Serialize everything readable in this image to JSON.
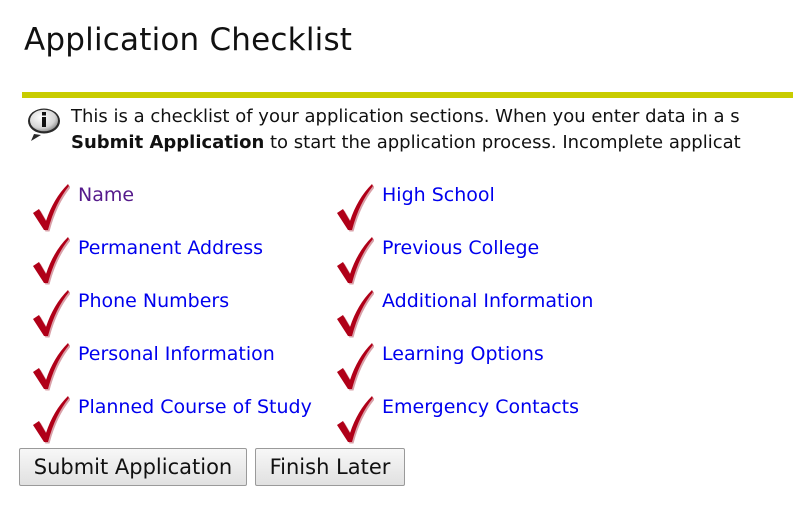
{
  "page": {
    "title": "Application Checklist"
  },
  "colors": {
    "rule": "#c8cc00",
    "link": "#0000ee",
    "visited_link": "#551a8b",
    "check": "#b00018"
  },
  "info": {
    "icon": "info-speech-bubble-icon",
    "line1": "This is a checklist of your application sections. When you enter data in a s",
    "line2_bold": "Submit Application",
    "line2_rest": " to start the application process. Incomplete applicat"
  },
  "checklist": {
    "icon": "checkmark-icon",
    "left_column": [
      {
        "label": "Name",
        "visited": true,
        "complete": true
      },
      {
        "label": "Permanent Address",
        "visited": false,
        "complete": true
      },
      {
        "label": "Phone Numbers",
        "visited": false,
        "complete": true
      },
      {
        "label": "Personal Information",
        "visited": false,
        "complete": true
      },
      {
        "label": "Planned Course of Study",
        "visited": false,
        "complete": true
      }
    ],
    "right_column": [
      {
        "label": "High School",
        "visited": false,
        "complete": true
      },
      {
        "label": "Previous College",
        "visited": false,
        "complete": true
      },
      {
        "label": "Additional Information",
        "visited": false,
        "complete": true
      },
      {
        "label": "Learning Options",
        "visited": false,
        "complete": true
      },
      {
        "label": "Emergency Contacts",
        "visited": false,
        "complete": true
      }
    ]
  },
  "buttons": {
    "submit_label": "Submit Application",
    "finish_later_label": "Finish Later"
  }
}
